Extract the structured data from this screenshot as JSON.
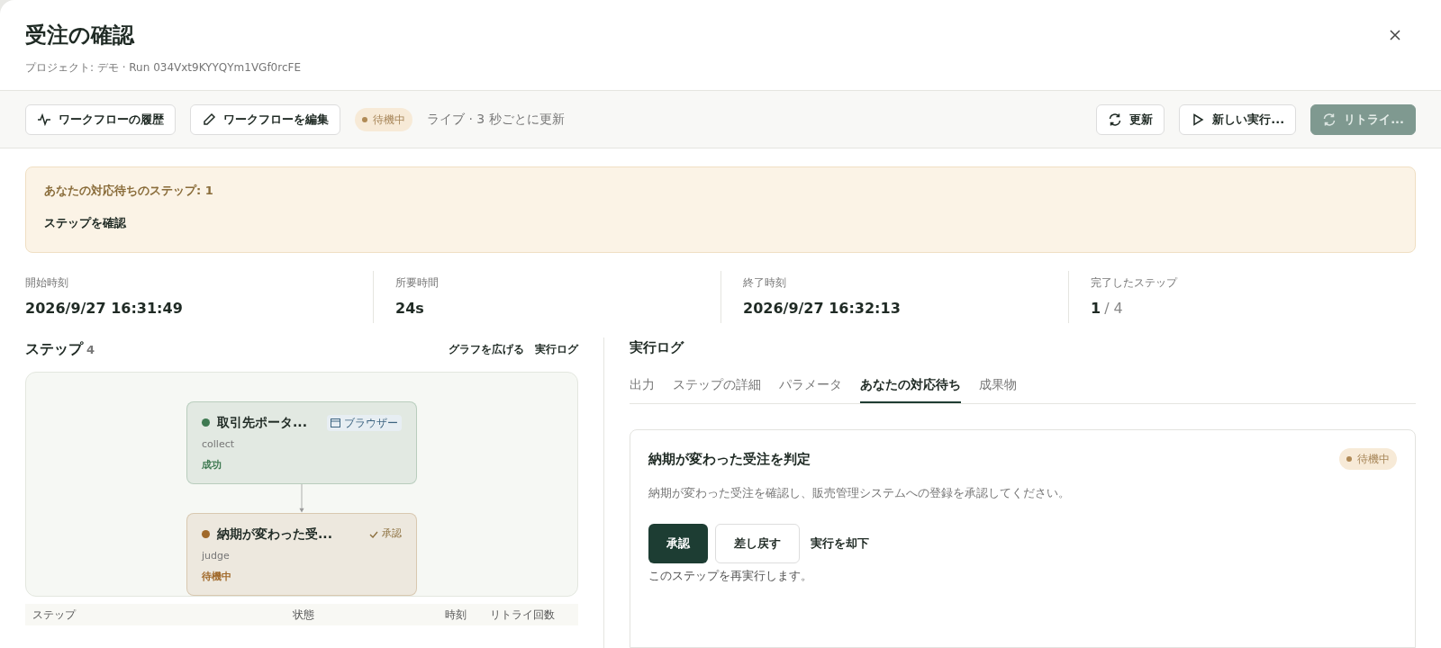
{
  "dialog": {
    "title": "受注の確認",
    "subtitle": "プロジェクト: デモ · Run 034Vxt9KYYQYm1VGf0rcFE"
  },
  "toolbar": {
    "left_buttons": [
      {
        "kind": "history",
        "label": "ワークフローの履歴"
      },
      {
        "kind": "edit",
        "label": "ワークフローを編集"
      }
    ],
    "status_badge": "待機中",
    "live_text": "ライブ · 3 秒ごとに更新",
    "right_buttons": [
      {
        "kind": "refresh",
        "label": "更新",
        "disabled": false
      },
      {
        "kind": "play",
        "label": "新しい実行...",
        "disabled": false
      },
      {
        "kind": "retry",
        "label": "リトライ...",
        "disabled": true
      }
    ]
  },
  "alert": {
    "title": "あなたの対応待ちのステップ: 1",
    "action": "ステップを確認"
  },
  "stats": [
    {
      "label": "開始時刻",
      "value": "2026/9/27 16:31:49"
    },
    {
      "label": "所要時間",
      "value": "24s"
    },
    {
      "label": "終了時刻",
      "value": "2026/9/27 16:32:13"
    },
    {
      "label": "完了したステップ",
      "value": "1",
      "total": "/ 4"
    }
  ],
  "steps": {
    "title": "ステップ",
    "count": "4",
    "links": [
      "グラフを広げる",
      "実行ログ"
    ],
    "nodes": [
      {
        "title": "取引先ポータ...",
        "key": "collect",
        "status": "成功",
        "color": "#3f7a52",
        "tag": {
          "kind": "browser",
          "label": "ブラウザー"
        }
      },
      {
        "title": "納期が変わった受...",
        "key": "judge",
        "status": "待機中",
        "color": "#a0692a",
        "tag": {
          "kind": "approval",
          "label": "承認"
        }
      }
    ],
    "table_columns": [
      "ステップ",
      "状態",
      "時刻",
      "リトライ回数"
    ]
  },
  "log": {
    "title": "実行ログ",
    "tabs": [
      {
        "label": "出力",
        "selected": false
      },
      {
        "label": "ステップの詳細",
        "selected": false
      },
      {
        "label": "パラメータ",
        "selected": false
      },
      {
        "label": "あなたの対応待ち",
        "selected": true
      },
      {
        "label": "成果物",
        "selected": false
      }
    ],
    "card": {
      "title": "納期が変わった受注を判定",
      "badge": "待機中",
      "description": "納期が変わった受注を確認し、販売管理システムへの登録を承認してください。",
      "buttons": [
        {
          "kind": "primary",
          "label": "承認"
        },
        {
          "kind": "secondary",
          "label": "差し戻す"
        },
        {
          "kind": "link",
          "label": "実行を却下"
        }
      ],
      "note": "このステップを再実行します。"
    }
  }
}
